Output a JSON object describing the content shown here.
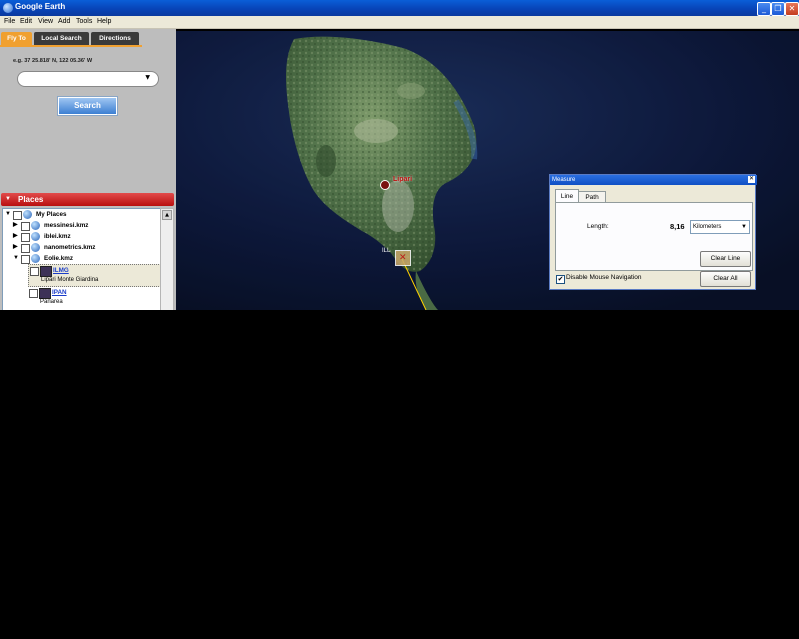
{
  "window": {
    "title": "Google Earth",
    "buttons": [
      "_",
      "❐",
      "✕"
    ]
  },
  "menu": [
    "File",
    "Edit",
    "View",
    "Add",
    "Tools",
    "Help"
  ],
  "search_panel": {
    "tabs": [
      "Fly To",
      "Local Search",
      "Directions"
    ],
    "active_tab": "Fly To",
    "hint": "e.g. 37 25.818' N, 122 05.36' W",
    "input_value": "",
    "search_label": "Search"
  },
  "places": {
    "header": "Places",
    "items": [
      {
        "label": "My Places"
      },
      {
        "label": "messinesi.kmz"
      },
      {
        "label": "iblei.kmz"
      },
      {
        "label": "nanometrics.kmz"
      },
      {
        "label": "Eolie.kmz"
      },
      {
        "label": "ILMG",
        "description": "Lipari Monte Giardina"
      },
      {
        "label": "IPAN",
        "description": "Panarea"
      }
    ]
  },
  "map": {
    "place_label": "Lipari",
    "marker_label": "ILL"
  },
  "measure": {
    "title": "Measure",
    "tabs": [
      "Line",
      "Path"
    ],
    "active_tab": "Line",
    "length_label": "Length:",
    "length_value": "8,16",
    "unit": "Kilometers",
    "clear_line": "Clear Line",
    "disable_nav_label": "Disable Mouse Navigation",
    "disable_nav_checked": true,
    "clear_all": "Clear All"
  },
  "colors": {
    "titlebar": "#0a4fc8",
    "places_header": "#c81616",
    "active_tab": "#f0a030",
    "inactive_tab": "#3a3a3a",
    "measure_line": "#ffd200"
  }
}
